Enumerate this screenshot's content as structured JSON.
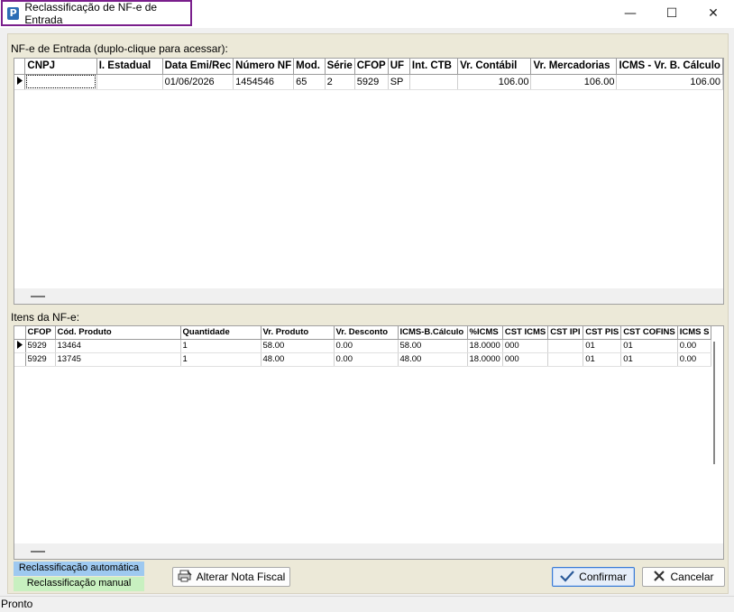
{
  "window": {
    "title": "Reclassificação de NF-e de Entrada",
    "icon": "app-p-icon",
    "controls": {
      "minimize": "—",
      "maximize": "☐",
      "close": "✕"
    }
  },
  "nfe_section": {
    "label": "NF-e de Entrada (duplo-clique para acessar):",
    "columns": [
      "CNPJ",
      "I. Estadual",
      "Data Emi/Rec",
      "Número NF",
      "Mod.",
      "Série",
      "CFOP",
      "UF",
      "Int. CTB",
      "Vr. Contábil",
      "Vr. Mercadorias",
      "ICMS - Vr. B. Cálculo"
    ],
    "rows": [
      [
        "",
        "",
        "01/06/2026",
        "1454546",
        "65",
        "2",
        "5929",
        "SP",
        "",
        "106.00",
        "106.00",
        "106.00"
      ]
    ]
  },
  "items_section": {
    "label": "Itens da NF-e:",
    "columns": [
      "CFOP",
      "Cód. Produto",
      "Quantidade",
      "Vr. Produto",
      "Vr. Desconto",
      "ICMS-B.Cálculo",
      "%ICMS",
      "CST ICMS",
      "CST IPI",
      "CST PIS",
      "CST COFINS",
      "ICMS S"
    ],
    "rows": [
      [
        "5929",
        "13464",
        "1",
        "58.00",
        "0.00",
        "58.00",
        "18.0000",
        "000",
        "",
        "01",
        "01",
        "0.00"
      ],
      [
        "5929",
        "13745",
        "1",
        "48.00",
        "0.00",
        "48.00",
        "18.0000",
        "000",
        "",
        "01",
        "01",
        "0.00"
      ]
    ]
  },
  "legend": {
    "auto": {
      "label": "Reclassificação automática",
      "color": "#9ec9f0"
    },
    "manual": {
      "label": "Reclassificação manual",
      "color": "#c8f0c0"
    }
  },
  "buttons": {
    "alter": {
      "label": "Alterar Nota Fiscal",
      "icon": "printer-edit-icon"
    },
    "confirm": {
      "label": "Confirmar",
      "icon": "checkmark-icon"
    },
    "cancel": {
      "label": "Cancelar",
      "icon": "x-icon"
    }
  },
  "status": {
    "text": "Pronto"
  }
}
